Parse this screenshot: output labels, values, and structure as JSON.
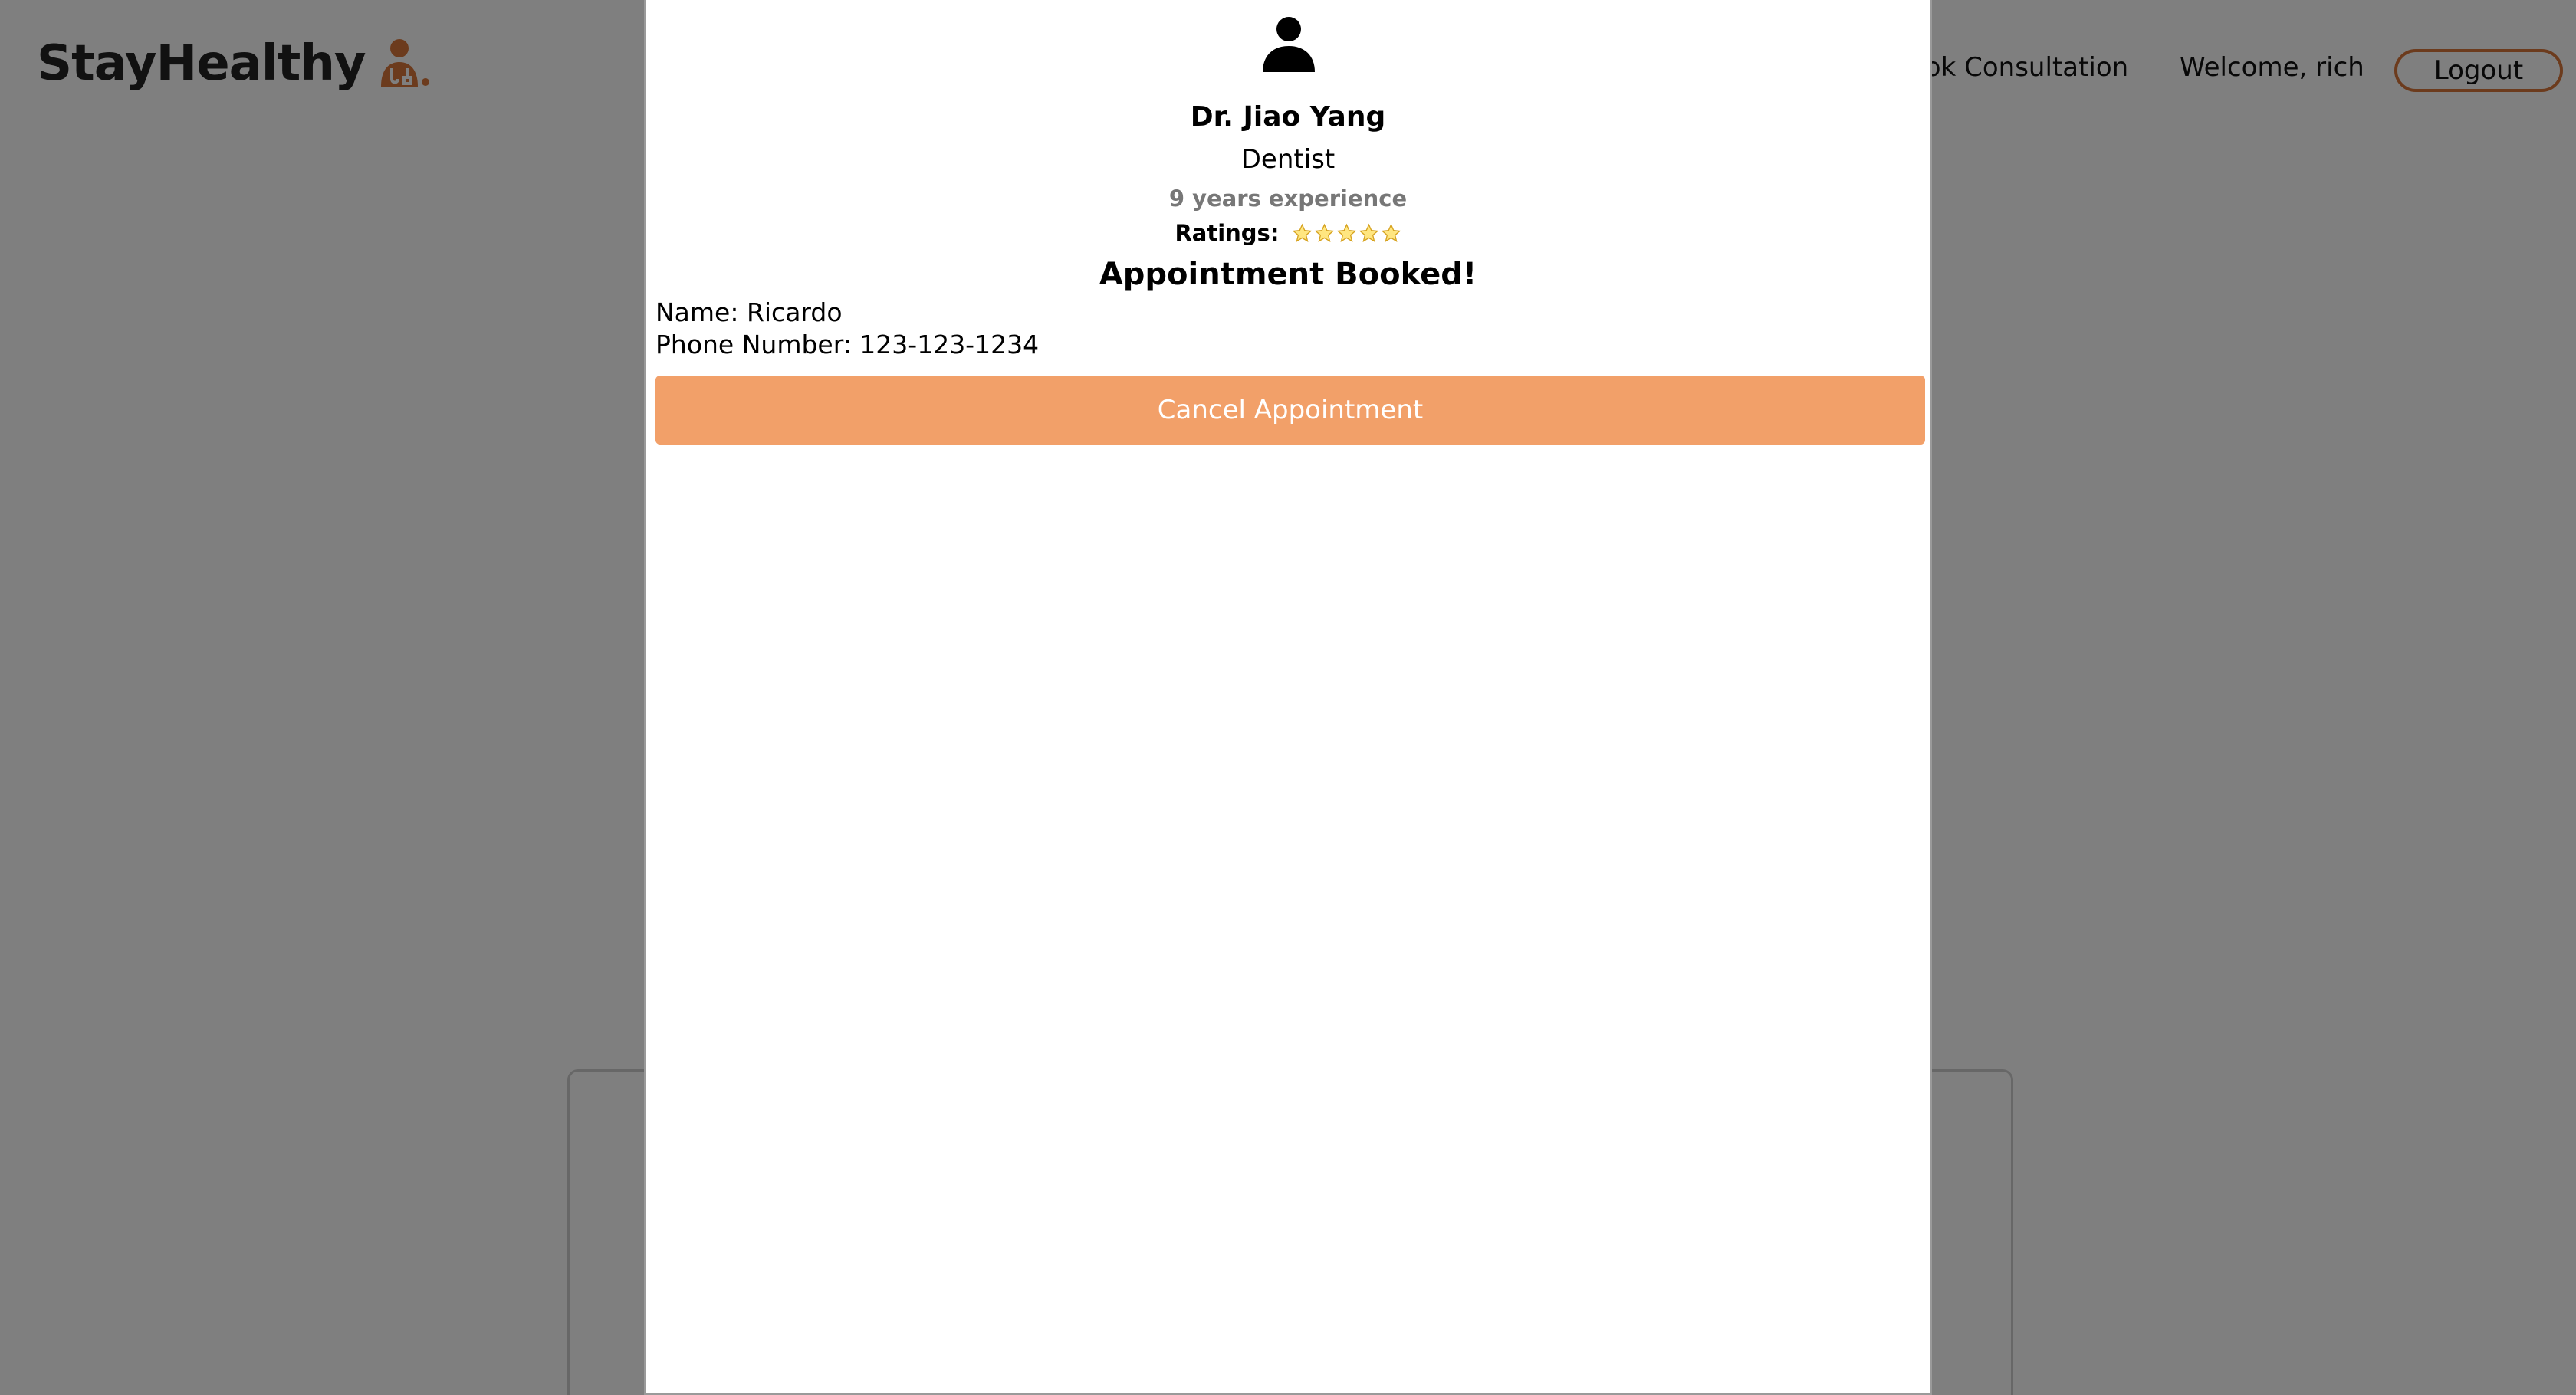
{
  "brand": {
    "name": "StayHealthy",
    "icon": "doctor-icon",
    "accent_color": "#d9773a"
  },
  "nav": {
    "book_consultation": "ook Consultation",
    "welcome": "Welcome, rich",
    "logout": "Logout"
  },
  "modal": {
    "avatar_icon": "person-icon",
    "doctor_name": "Dr. Jiao Yang",
    "speciality": "Dentist",
    "experience": "9 years experience",
    "ratings_label": "Ratings:",
    "rating_stars": 5,
    "status": "Appointment Booked!",
    "patient_name": "Name: Ricardo",
    "patient_phone": "Phone Number: 123-123-1234",
    "cancel_label": "Cancel Appointment",
    "cancel_color": "#f2a069"
  }
}
